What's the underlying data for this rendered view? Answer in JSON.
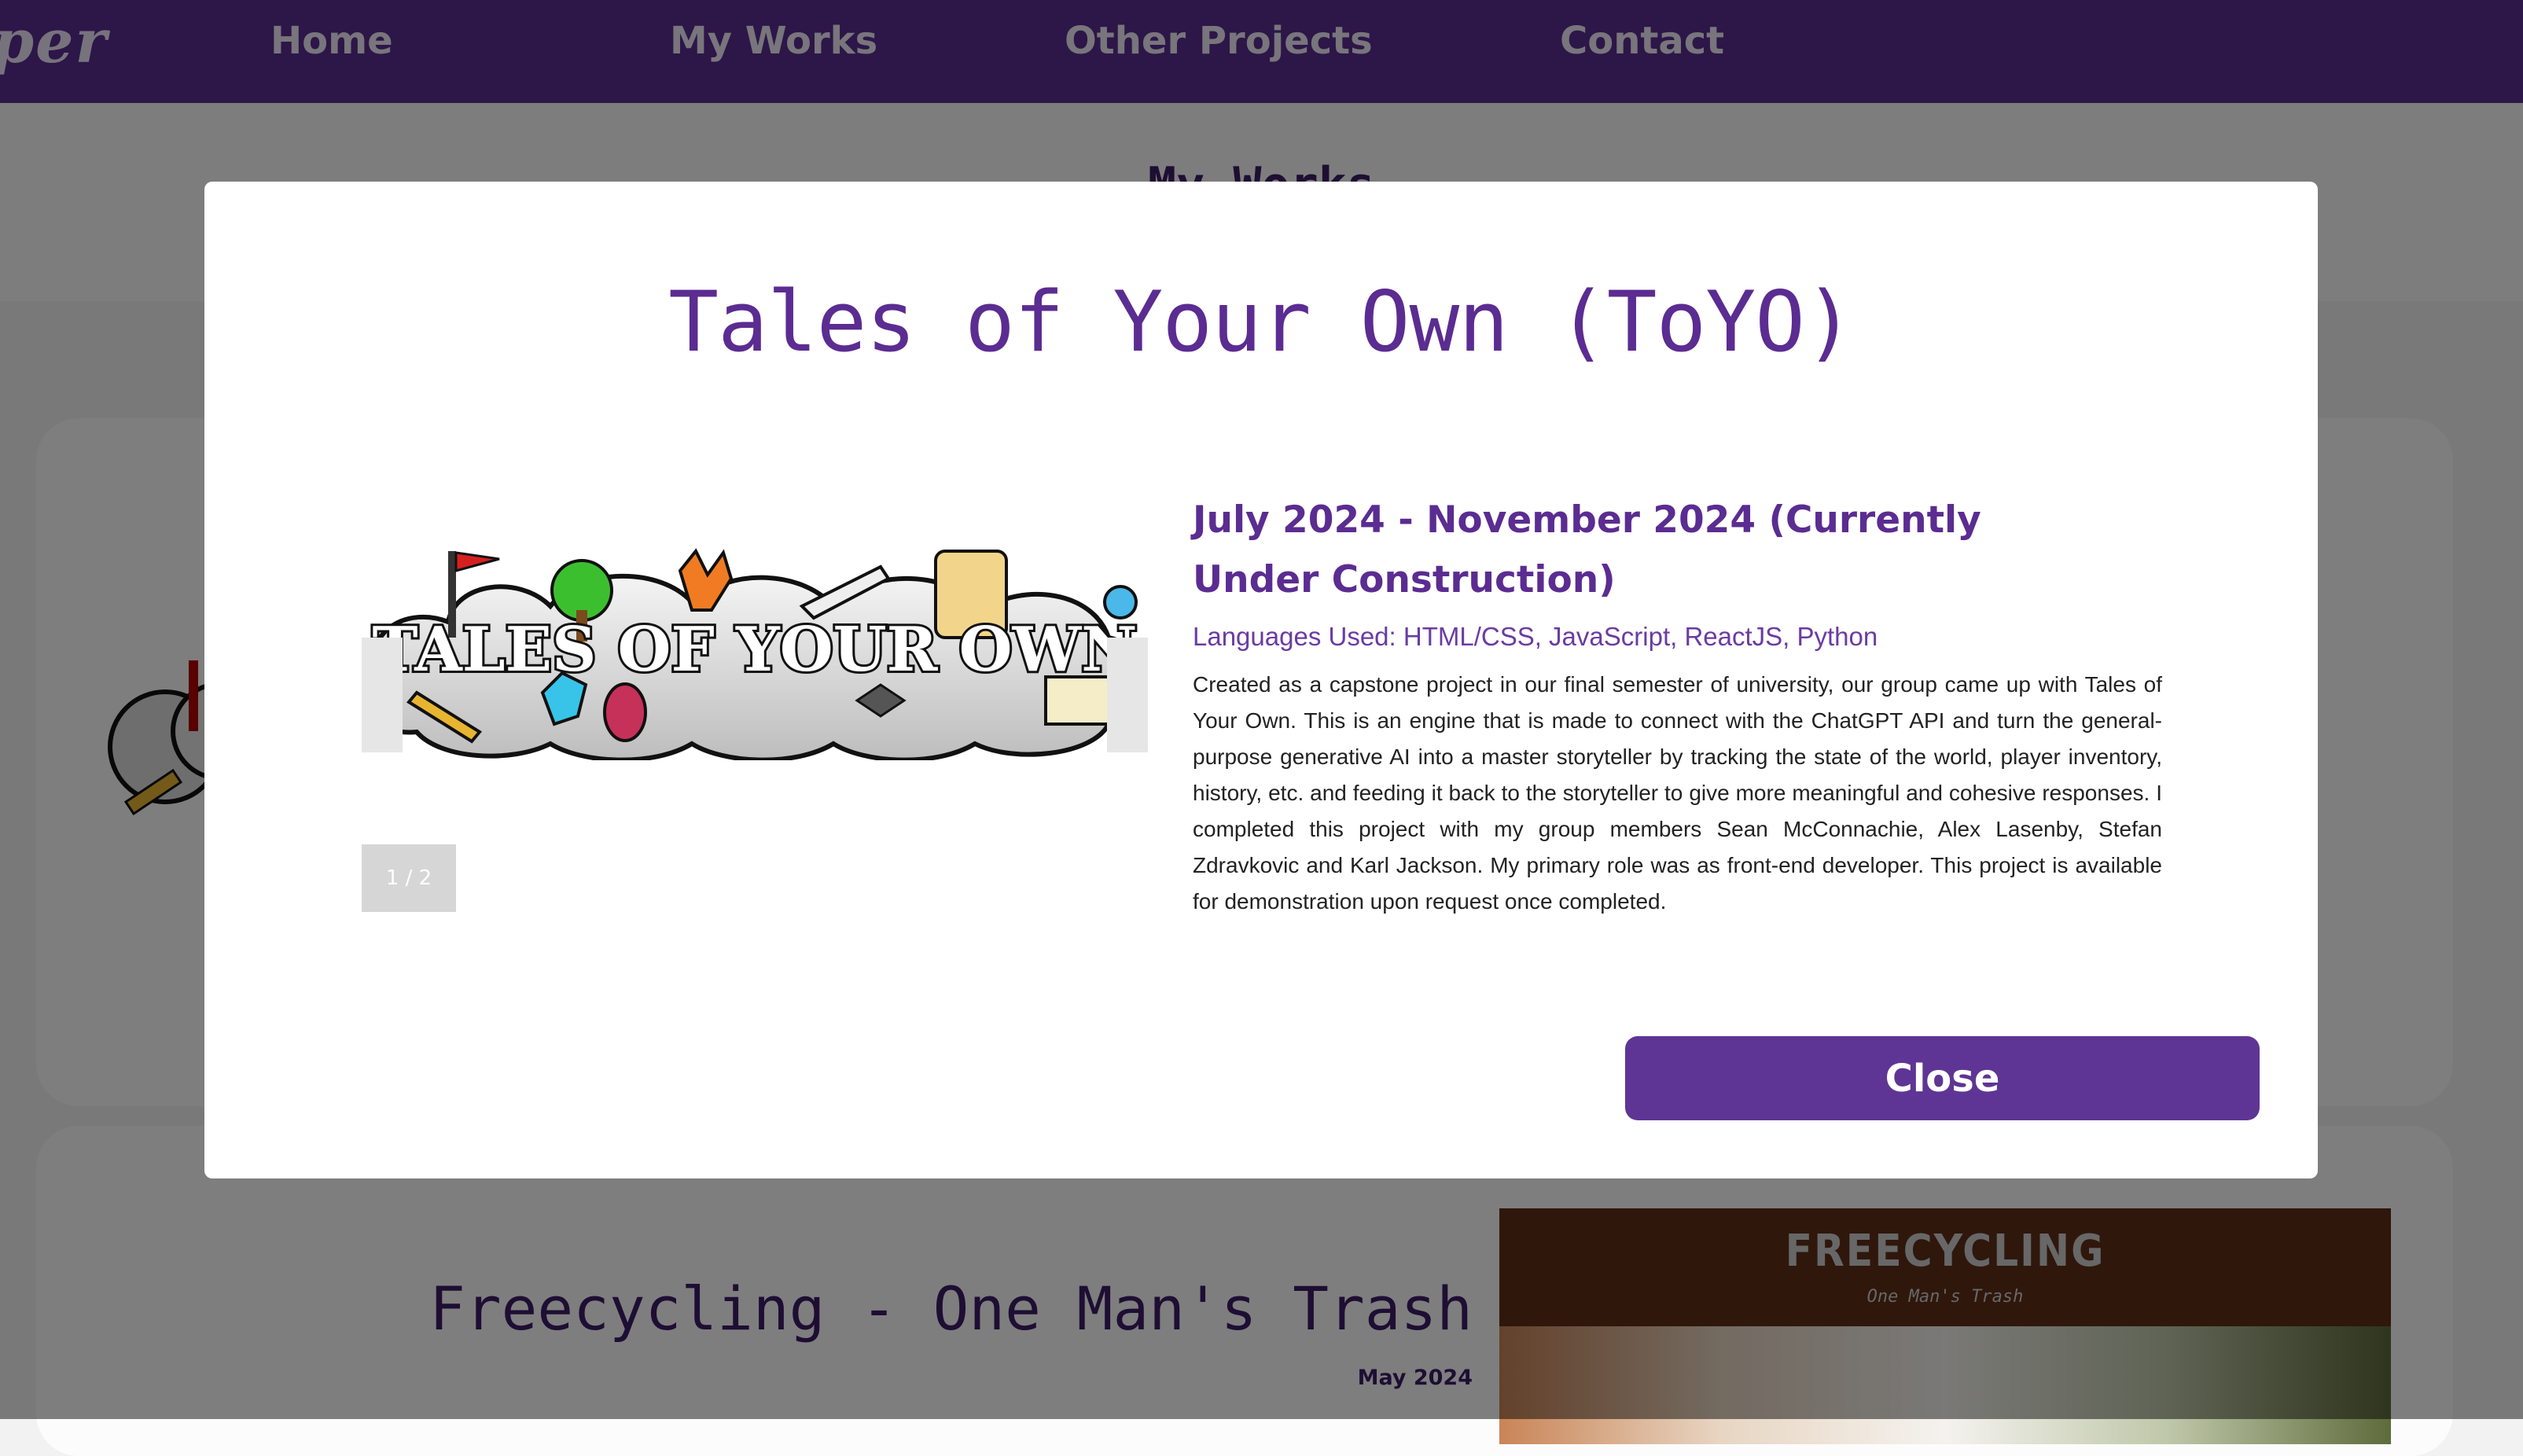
{
  "nav": {
    "brand": "per",
    "links": [
      "Home",
      "My Works",
      "Other Projects",
      "Contact"
    ]
  },
  "background": {
    "section_heading": "My Works",
    "project2": {
      "title": "Freecycling - One Man's Trash",
      "date": "May 2024",
      "image_title": "FREECYCLING",
      "image_subtitle": "One Man's Trash"
    }
  },
  "modal": {
    "title": "Tales of Your Own (ToYO)",
    "slide": {
      "logo_text": "TALES OF YOUR OWN",
      "counter": "1 / 2"
    },
    "date": "July 2024 - November 2024 (Currently Under Construction)",
    "languages": "Languages Used: HTML/CSS, JavaScript, ReactJS, Python",
    "description": "Created as a capstone project in our final semester of university, our group came up with Tales of Your Own. This is an engine that is made to connect with the ChatGPT API and turn the general-purpose generative AI into a master storyteller by tracking the state of the world, player inventory, history, etc. and feeding it back to the storyteller to give more meaningful and cohesive responses. I completed this project with my group members Sean McConnachie, Alex Lasenby, Stefan Zdravkovic and Karl Jackson. My primary role was as front-end developer. This project is available for demonstration upon request once completed.",
    "close_label": "Close"
  },
  "colors": {
    "accent_purple": "#5b2c91",
    "close_button": "#5e3594"
  }
}
